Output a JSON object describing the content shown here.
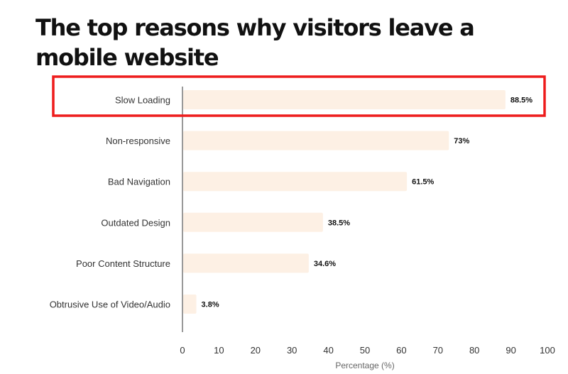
{
  "title": "The top reasons why visitors leave a mobile website",
  "highlight": {
    "category": "Slow Loading",
    "color": "#ee1c1c"
  },
  "colors": {
    "bar": "#fdf0e4",
    "axis": "#555555"
  },
  "chart_data": {
    "type": "bar",
    "orientation": "horizontal",
    "title": "The top reasons why visitors leave a mobile website",
    "categories": [
      "Slow Loading",
      "Non-responsive",
      "Bad Navigation",
      "Outdated Design",
      "Poor Content Structure",
      "Obtrusive Use of Video/Audio"
    ],
    "values": [
      88.5,
      73,
      61.5,
      38.5,
      34.6,
      3.8
    ],
    "value_labels": [
      "88.5%",
      "73%",
      "61.5%",
      "38.5%",
      "34.6%",
      "3.8%"
    ],
    "xlabel": "Percentage (%)",
    "ylabel": "",
    "xlim": [
      0,
      100
    ],
    "xticks": [
      0,
      10,
      20,
      30,
      40,
      50,
      60,
      70,
      80,
      90,
      100
    ],
    "grid": false,
    "legend": "none"
  }
}
